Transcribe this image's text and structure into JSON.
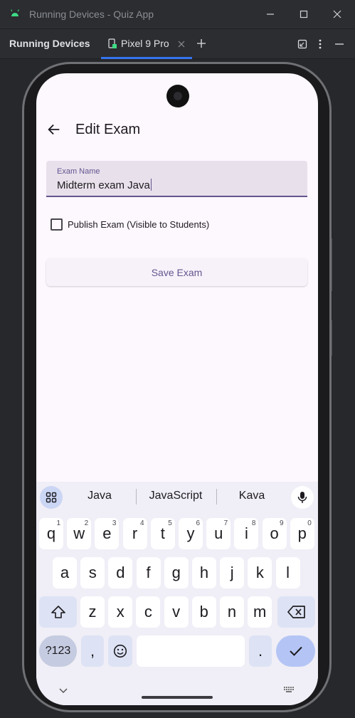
{
  "window": {
    "title": "Running Devices - Quiz App",
    "minimize_icon": "minimize-icon",
    "maximize_icon": "maximize-icon",
    "close_icon": "close-icon"
  },
  "toolwindow": {
    "title": "Running Devices",
    "tab_label": "Pixel 9 Pro",
    "accent": "#3574f0"
  },
  "app": {
    "title": "Edit Exam",
    "field_label": "Exam Name",
    "field_value": "Midterm exam Java",
    "checkbox_label": "Publish Exam (Visible to Students)",
    "checkbox_checked": false,
    "save_label": "Save Exam",
    "primary_color": "#65558f"
  },
  "keyboard": {
    "suggestions": [
      "Java",
      "JavaScript",
      "Kava"
    ],
    "row1": [
      {
        "k": "q",
        "h": "1"
      },
      {
        "k": "w",
        "h": "2"
      },
      {
        "k": "e",
        "h": "3"
      },
      {
        "k": "r",
        "h": "4"
      },
      {
        "k": "t",
        "h": "5"
      },
      {
        "k": "y",
        "h": "6"
      },
      {
        "k": "u",
        "h": "7"
      },
      {
        "k": "i",
        "h": "8"
      },
      {
        "k": "o",
        "h": "9"
      },
      {
        "k": "p",
        "h": "0"
      }
    ],
    "row2": [
      "a",
      "s",
      "d",
      "f",
      "g",
      "h",
      "j",
      "k",
      "l"
    ],
    "row3": [
      "z",
      "x",
      "c",
      "v",
      "b",
      "n",
      "m"
    ],
    "symbols_label": "?123",
    "comma_label": ",",
    "period_label": "."
  }
}
